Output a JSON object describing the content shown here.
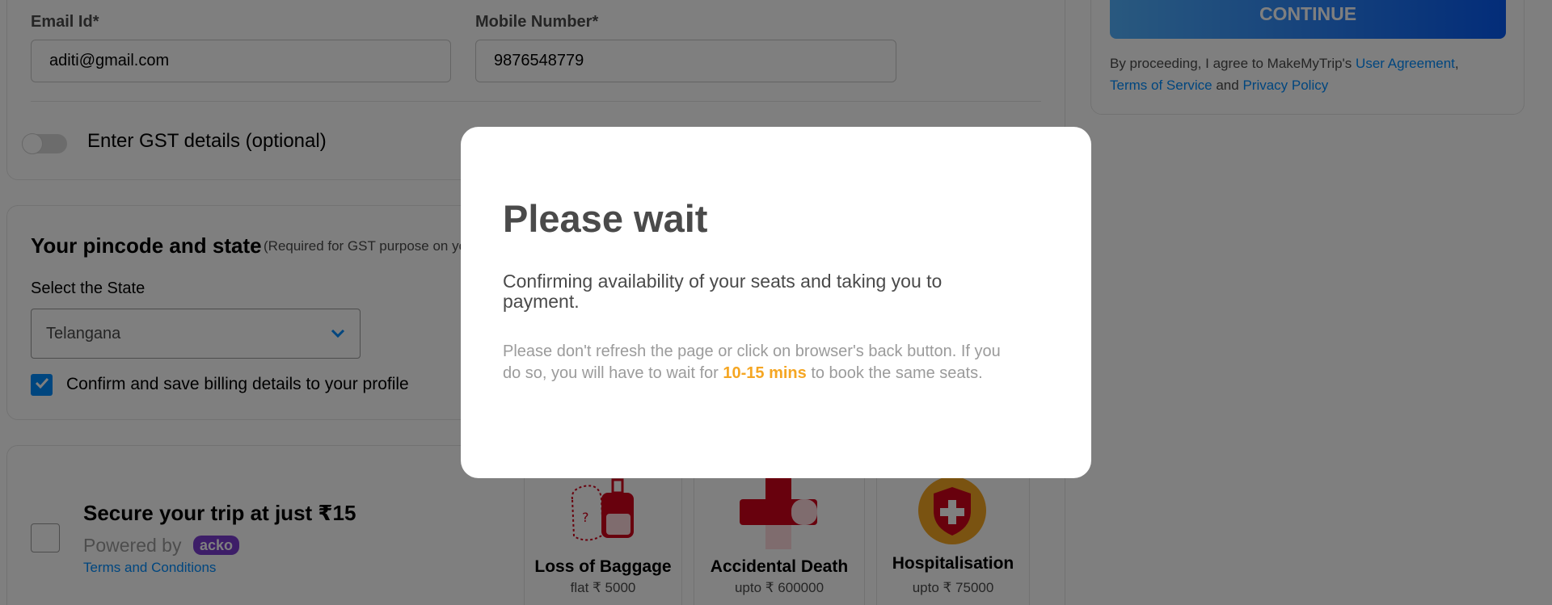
{
  "contact": {
    "email_label": "Email Id*",
    "email_value": "aditi@gmail.com",
    "mobile_label": "Mobile Number*",
    "mobile_value": "9876548779",
    "gst_toggle_label": "Enter GST details (optional)"
  },
  "pincode": {
    "title": "Your pincode and state",
    "subtitle": "(Required for GST purpose on your tax invoice. You can edit this anytime later in your profile section.)",
    "state_label": "Select the State",
    "state_value": "Telangana",
    "confirm_label": "Confirm and save billing details to your profile"
  },
  "insurance": {
    "title": "Secure your trip at just ₹15",
    "powered_by": "Powered by",
    "brand": "acko",
    "terms": "Terms and Conditions",
    "benefits": [
      {
        "name": "Loss of Baggage",
        "amount": "flat ₹ 5000"
      },
      {
        "name": "Accidental Death",
        "amount": "upto ₹ 600000"
      },
      {
        "name": "Hospitalisation",
        "amount": "upto ₹ 75000"
      }
    ]
  },
  "sidebar": {
    "continue_label": "CONTINUE",
    "agree_text": "By proceeding, I agree to MakeMyTrip's",
    "user_agreement": "User Agreement",
    "comma": ",",
    "terms_of_service": "Terms of Service",
    "and_text": "and",
    "privacy_policy": "Privacy Policy"
  },
  "modal": {
    "title": "Please wait",
    "message": "Confirming availability of your seats and taking you to payment.",
    "warning_before": "Please don't refresh the page or click on browser's back button. If you do so, you will have to wait for",
    "warning_highlight": "10-15 mins",
    "warning_after": "to book the same seats."
  },
  "colors": {
    "primary": "#008cff",
    "overlay": "rgba(0,0,0,0.5)",
    "highlight": "#f5a623",
    "toggle_off": "#d8d8d8"
  },
  "icons": {
    "checkbox_checked": "check-icon",
    "state_dropdown": "chevron-down-icon",
    "baggage": "luggage-icon",
    "accident": "bandage-cross-icon",
    "hospital": "shield-cross-icon"
  }
}
